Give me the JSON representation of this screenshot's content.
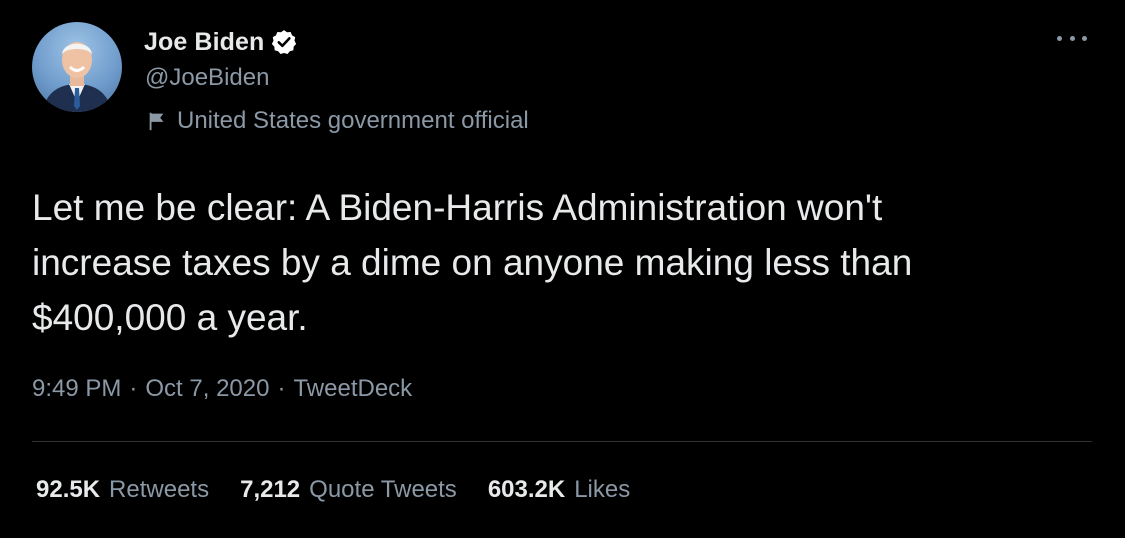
{
  "user": {
    "display_name": "Joe Biden",
    "handle": "@JoeBiden",
    "label": "United States government official",
    "verified": true
  },
  "icons": {
    "verified": "verified-badge-icon",
    "flag": "flag-icon",
    "more": "more-options-icon"
  },
  "tweet": {
    "text": "Let me be clear: A Biden-Harris Administration won't\nincrease taxes by a dime on anyone making less than\n$400,000 a year.",
    "time": "9:49 PM",
    "separator": "·",
    "date": "Oct 7, 2020",
    "source": "TweetDeck"
  },
  "stats": {
    "retweets": {
      "count": "92.5K",
      "label": "Retweets"
    },
    "quote_tweets": {
      "count": "7,212",
      "label": "Quote Tweets"
    },
    "likes": {
      "count": "603.2K",
      "label": "Likes"
    }
  },
  "colors": {
    "background": "#000000",
    "primary_text": "#e7e9ea",
    "secondary_text": "#8b98a5",
    "divider": "#2f3336"
  }
}
